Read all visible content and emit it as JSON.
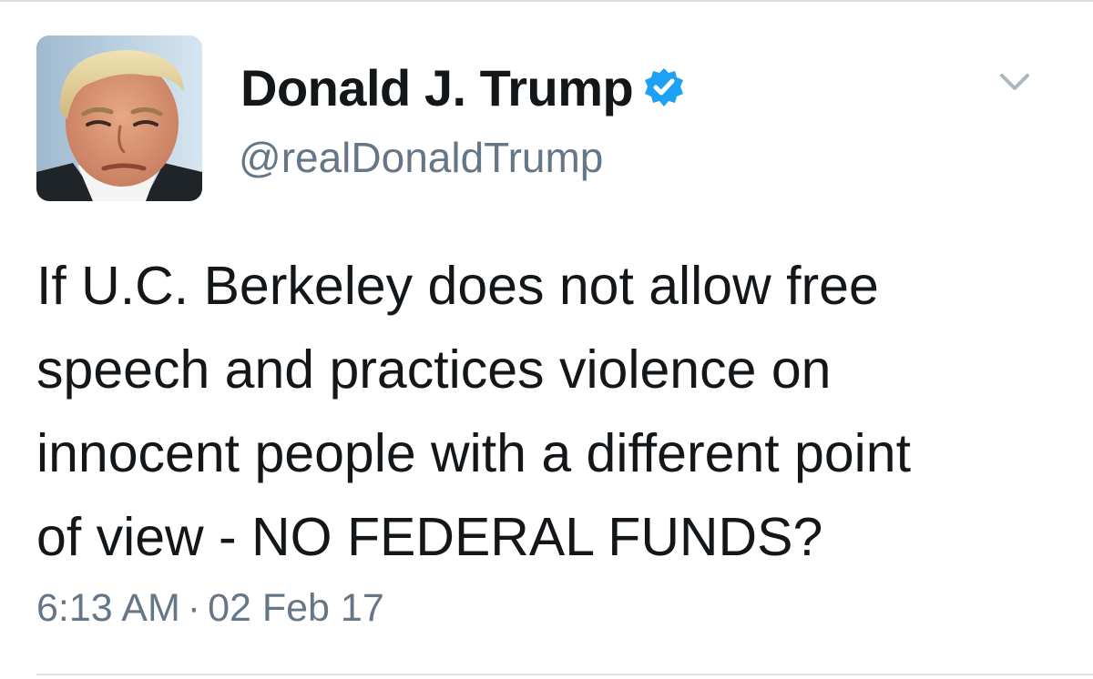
{
  "user": {
    "display_name": "Donald J. Trump",
    "handle": "@realDonaldTrump",
    "verified": true,
    "verified_icon": "verified-badge-icon",
    "avatar_icon": "profile-photo"
  },
  "tweet": {
    "lines": [
      "If U.C. Berkeley does not allow free",
      "speech and practices violence on",
      "innocent people with a different point",
      "of view - NO FEDERAL FUNDS?"
    ],
    "time": "6:13 AM",
    "separator": "·",
    "date": "02 Feb 17"
  },
  "menu": {
    "icon": "chevron-down-icon"
  },
  "colors": {
    "text": "#14171a",
    "secondary": "#657786",
    "verified": "#1da1f2",
    "divider": "#dfe3e8"
  }
}
